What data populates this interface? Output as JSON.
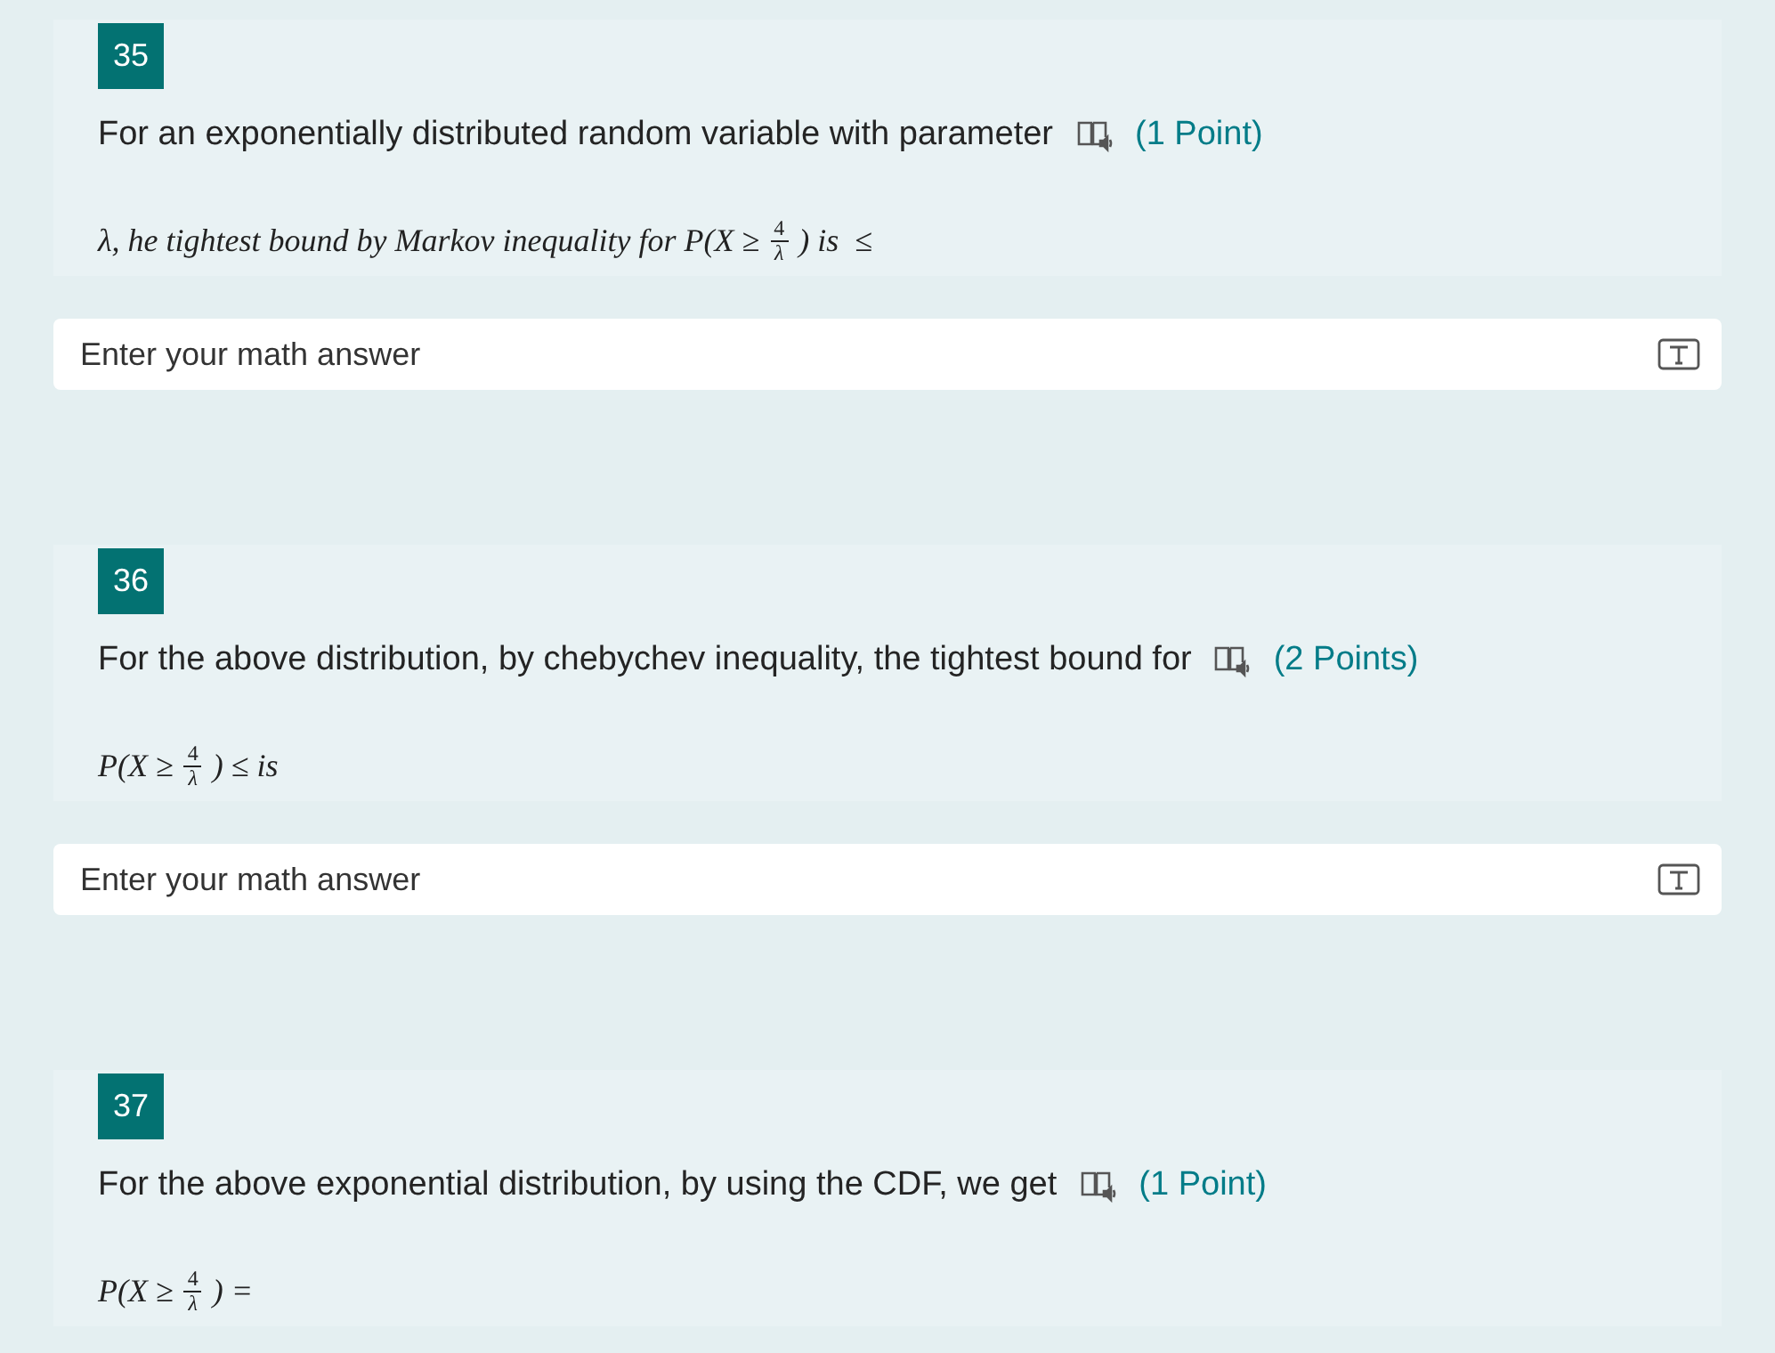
{
  "questions": [
    {
      "number": "35",
      "text": "For an exponentially distributed random variable with parameter",
      "points": "(1 Point)",
      "formula": {
        "before": "λ, he tightest bound by Markov inequality for P(X ≥",
        "numerator": "4",
        "denominator": "λ",
        "after": ") is  ≤"
      },
      "answer": {
        "placeholder": "Enter your math answer"
      }
    },
    {
      "number": "36",
      "text": "For the above distribution, by chebychev inequality, the tightest bound for",
      "points": "(2 Points)",
      "formula": {
        "before": "P(X ≥",
        "numerator": "4",
        "denominator": "λ",
        "after": ") ≤ is"
      },
      "answer": {
        "placeholder": "Enter your math answer"
      }
    },
    {
      "number": "37",
      "text": "For the above exponential distribution, by using the CDF, we get",
      "points": "(1 Point)",
      "formula": {
        "before": "P(X ≥",
        "numerator": "4",
        "denominator": "λ",
        "after": ") ="
      }
    }
  ]
}
